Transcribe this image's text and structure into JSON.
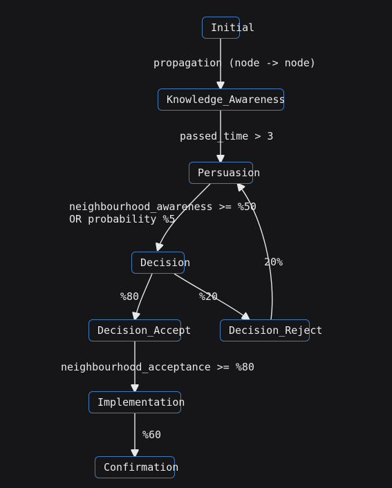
{
  "diagram": {
    "nodes": {
      "initial": "Initial",
      "knowledge_awareness": "Knowledge_Awareness",
      "persuasion": "Persuasion",
      "decision": "Decision",
      "decision_accept": "Decision_Accept",
      "decision_reject": "Decision_Reject",
      "implementation": "Implementation",
      "confirmation": "Confirmation"
    },
    "edges": {
      "initial_to_knowledge": "propagation (node -> node)",
      "knowledge_to_persuasion": "passed_time > 3",
      "persuasion_to_decision": "neighbourhood_awareness >= %50\nOR probability %5",
      "decision_to_accept": "%80",
      "decision_to_reject": "%20",
      "reject_to_persuasion": "20%",
      "accept_to_implementation": "neighbourhood_acceptance >= %80",
      "implementation_to_confirmation": "%60"
    }
  },
  "chart_data": {
    "type": "diagram",
    "title": "",
    "nodes": [
      {
        "id": "Initial"
      },
      {
        "id": "Knowledge_Awareness"
      },
      {
        "id": "Persuasion"
      },
      {
        "id": "Decision"
      },
      {
        "id": "Decision_Accept"
      },
      {
        "id": "Decision_Reject"
      },
      {
        "id": "Implementation"
      },
      {
        "id": "Confirmation"
      }
    ],
    "edges": [
      {
        "from": "Initial",
        "to": "Knowledge_Awareness",
        "label": "propagation (node -> node)"
      },
      {
        "from": "Knowledge_Awareness",
        "to": "Persuasion",
        "label": "passed_time > 3"
      },
      {
        "from": "Persuasion",
        "to": "Decision",
        "label": "neighbourhood_awareness >= %50 OR probability %5"
      },
      {
        "from": "Decision",
        "to": "Decision_Accept",
        "label": "%80"
      },
      {
        "from": "Decision",
        "to": "Decision_Reject",
        "label": "%20"
      },
      {
        "from": "Decision_Reject",
        "to": "Persuasion",
        "label": "20%"
      },
      {
        "from": "Decision_Accept",
        "to": "Implementation",
        "label": "neighbourhood_acceptance >= %80"
      },
      {
        "from": "Implementation",
        "to": "Confirmation",
        "label": "%60"
      }
    ]
  }
}
